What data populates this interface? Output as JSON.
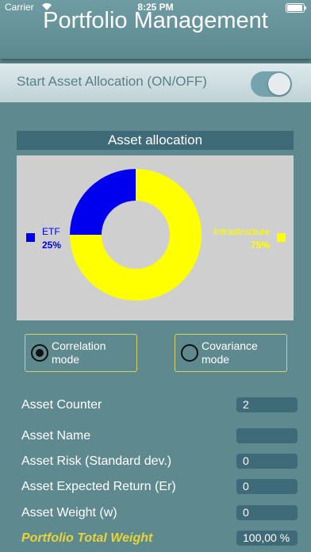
{
  "status_bar": {
    "carrier": "Carrier",
    "time": "8:25 PM"
  },
  "app": {
    "title": "Portfolio Management"
  },
  "toggle": {
    "label": "Start Asset Allocation (ON/OFF)",
    "on": true
  },
  "allocation": {
    "header": "Asset allocation",
    "chart_data": {
      "type": "pie",
      "categories": [
        "ETF",
        "Infrastructure"
      ],
      "values": [
        25,
        75
      ],
      "labels": [
        "25%",
        "75%"
      ],
      "colors": [
        "#0000ee",
        "#ffff00"
      ]
    }
  },
  "modes": {
    "correlation": {
      "line1": "Correlation",
      "line2": "mode",
      "selected": true
    },
    "covariance": {
      "line1": "Covariance",
      "line2": "mode",
      "selected": false
    }
  },
  "fields": [
    {
      "label": "Asset Counter",
      "value": "2"
    },
    {
      "label": "Asset Name",
      "value": ""
    },
    {
      "label": "Asset Risk (Standard dev.)",
      "value": "0"
    },
    {
      "label": "Asset Expected Return (Er)",
      "value": "0"
    },
    {
      "label": "Asset Weight (w)",
      "value": "0"
    },
    {
      "label": "Portfolio Total Weight",
      "value": "100,00 %"
    }
  ]
}
